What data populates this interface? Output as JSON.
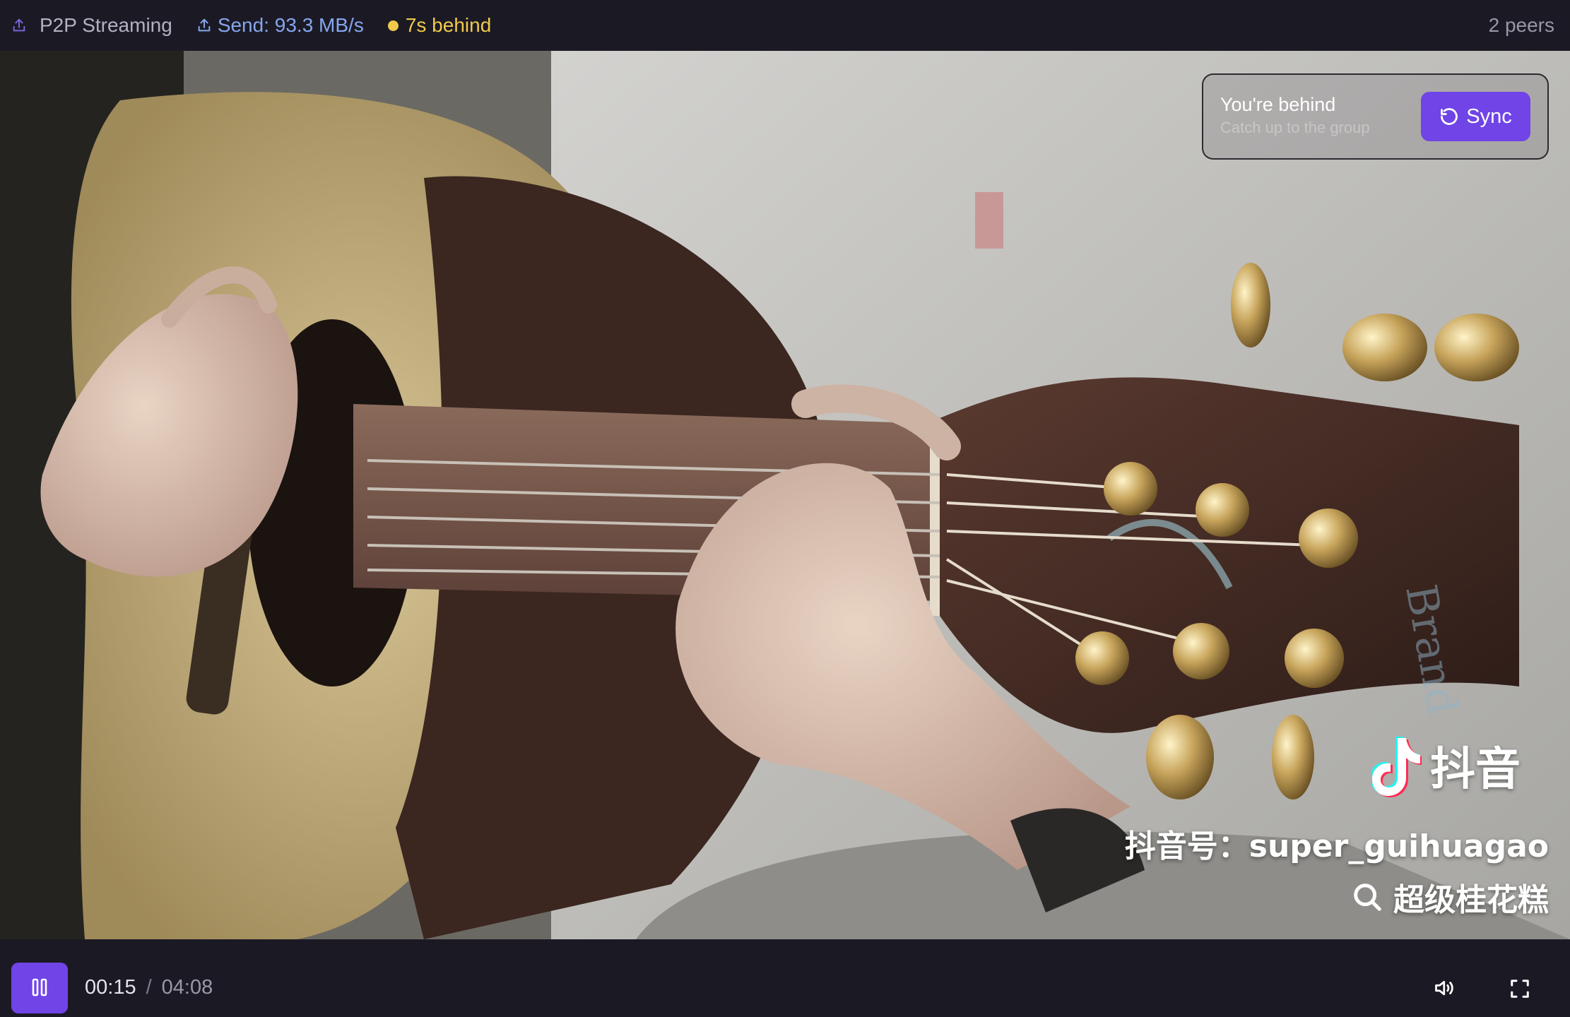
{
  "status_bar": {
    "mode_label": "P2P Streaming",
    "send_label": "Send: 93.3 MB/s",
    "sync_status": "7s behind",
    "peers": "2 peers",
    "mode_icon": "upload-icon",
    "send_icon": "upload-icon",
    "colors": {
      "send": "#86a6ee",
      "behind": "#f1c94b",
      "accent": "#7044e6"
    }
  },
  "sync_toast": {
    "title": "You're behind",
    "subtitle": "Catch up to the group",
    "button_label": "Sync",
    "button_icon": "rotate-ccw-icon"
  },
  "watermark": {
    "brand": "抖音",
    "brand_icon": "tiktok-note-icon",
    "handle": "抖音号：super_guihuagao",
    "search_text": "超级桂花糕",
    "search_icon": "search-icon"
  },
  "controls": {
    "play_state_icon": "pause-icon",
    "current_time": "00:15",
    "separator": "/",
    "duration": "04:08",
    "volume_icon": "volume-icon",
    "fullscreen_icon": "fullscreen-icon"
  }
}
